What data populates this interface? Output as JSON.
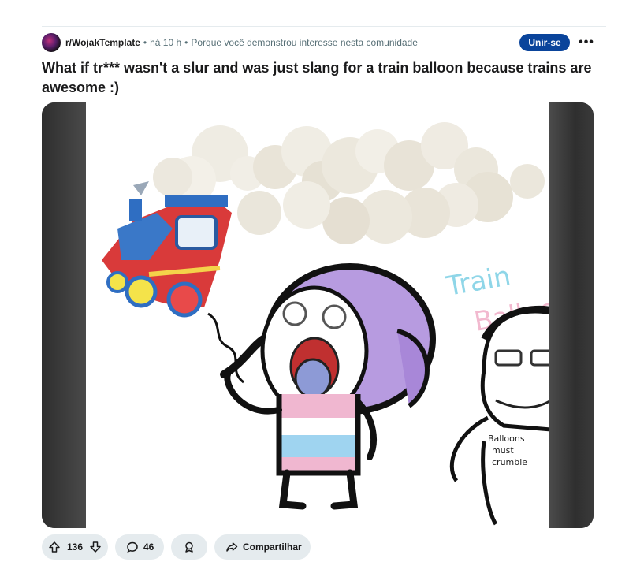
{
  "post": {
    "subreddit": "r/WojakTemplate",
    "separator": "•",
    "time": "há 10 h",
    "reason": "Porque você demonstrou interesse nesta comunidade",
    "join_label": "Unir-se",
    "more_label": "•••",
    "title": "What if tr*** wasn't a slur and was just slang for a train balloon because trains are awesome :)"
  },
  "image": {
    "text_train": "Train",
    "text_balloon": "Balloon",
    "question_mark": "?",
    "shirt_text_line1": "Balloons",
    "shirt_text_line2": "must",
    "shirt_text_line3": "crumble"
  },
  "actions": {
    "upvotes": "136",
    "comments": "46",
    "share_label": "Compartilhar"
  }
}
